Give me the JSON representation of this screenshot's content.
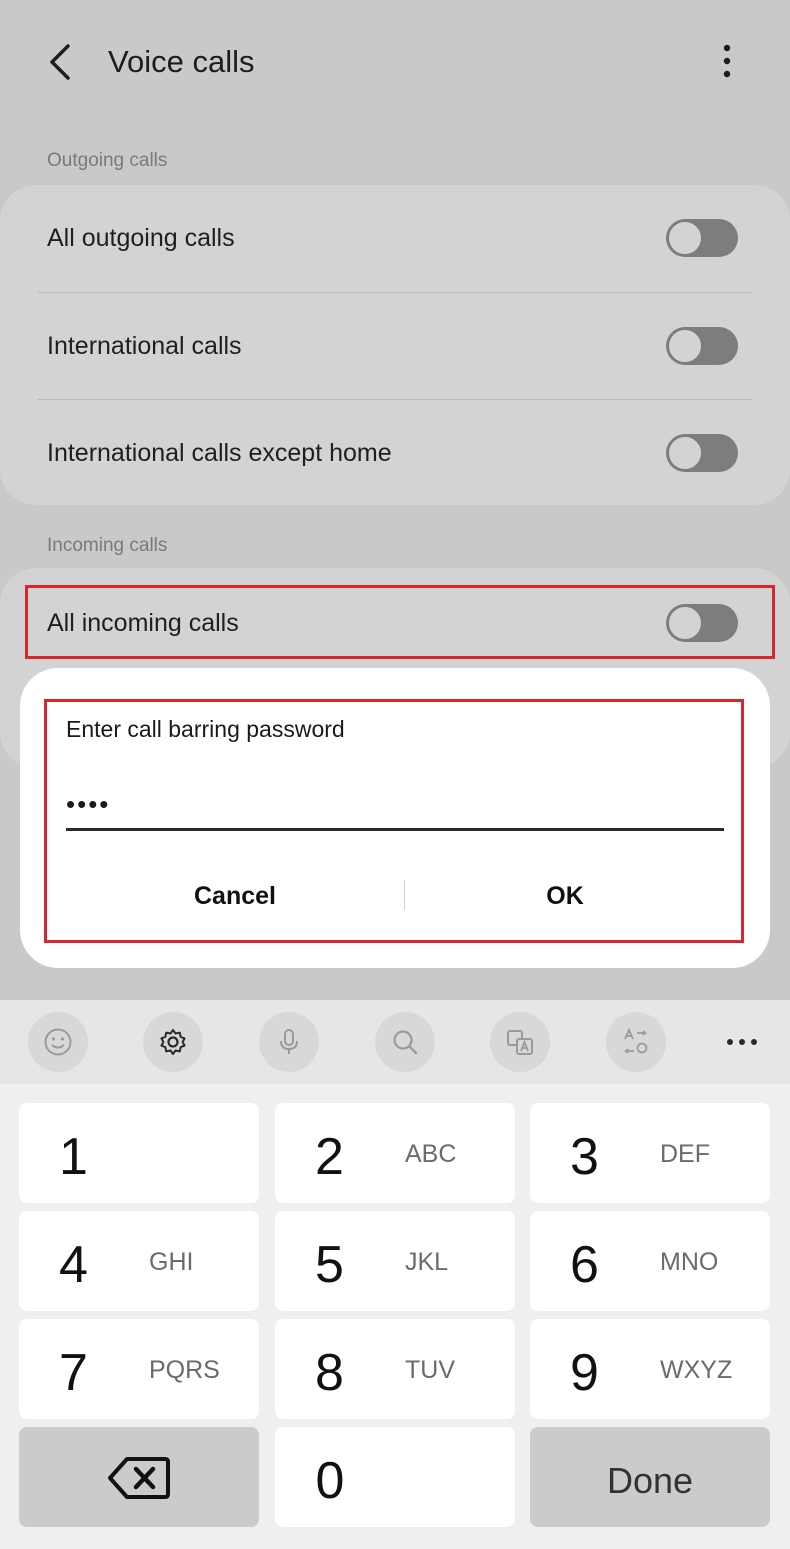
{
  "header": {
    "title": "Voice calls",
    "back_icon": "back-arrow-icon",
    "more_icon": "more-vertical-icon"
  },
  "outgoing": {
    "section_label": "Outgoing calls",
    "items": [
      {
        "label": "All outgoing calls",
        "enabled": false
      },
      {
        "label": "International calls",
        "enabled": false
      },
      {
        "label": "International calls except home",
        "enabled": false
      }
    ]
  },
  "incoming": {
    "section_label": "Incoming calls",
    "items": [
      {
        "label": "All incoming calls",
        "enabled": false
      }
    ]
  },
  "dialog": {
    "title": "Enter call barring password",
    "password_value": "••••",
    "cancel_label": "Cancel",
    "ok_label": "OK"
  },
  "keyboard_toolbar": {
    "icons": [
      "emoji-icon",
      "settings-icon",
      "microphone-icon",
      "search-icon",
      "translate-icon",
      "text-convert-icon",
      "more-horizontal-icon"
    ]
  },
  "keypad": {
    "keys": [
      {
        "num": "1",
        "letters": ""
      },
      {
        "num": "2",
        "letters": "ABC"
      },
      {
        "num": "3",
        "letters": "DEF"
      },
      {
        "num": "4",
        "letters": "GHI"
      },
      {
        "num": "5",
        "letters": "JKL"
      },
      {
        "num": "6",
        "letters": "MNO"
      },
      {
        "num": "7",
        "letters": "PQRS"
      },
      {
        "num": "8",
        "letters": "TUV"
      },
      {
        "num": "9",
        "letters": "WXYZ"
      },
      {
        "num": "0",
        "letters": ""
      }
    ],
    "backspace_icon": "backspace-icon",
    "done_label": "Done"
  },
  "colors": {
    "highlight": "#d9262d",
    "toggle_off": "#7d7d7d",
    "dialog_bg": "#ffffff"
  }
}
